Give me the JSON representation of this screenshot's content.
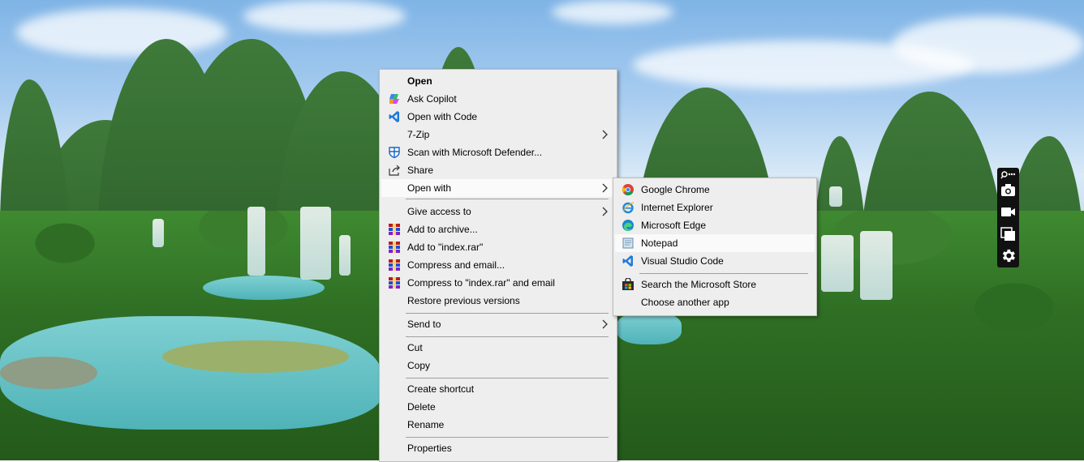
{
  "context_menu": {
    "items": [
      {
        "label": "Open",
        "bold": true,
        "icon": "none"
      },
      {
        "label": "Ask Copilot",
        "icon": "copilot-icon"
      },
      {
        "label": "Open with Code",
        "icon": "vscode-icon"
      },
      {
        "label": "7-Zip",
        "icon": "none",
        "submenu": true
      },
      {
        "label": "Scan with Microsoft Defender...",
        "icon": "defender-icon"
      },
      {
        "label": "Share",
        "icon": "share-icon"
      },
      {
        "label": "Open with",
        "icon": "none",
        "submenu": true,
        "highlighted": true
      },
      {
        "label": "Give access to",
        "icon": "none",
        "submenu": true
      },
      {
        "label": "Add to archive...",
        "icon": "winrar-icon"
      },
      {
        "label": "Add to \"index.rar\"",
        "icon": "winrar-icon"
      },
      {
        "label": "Compress and email...",
        "icon": "winrar-icon"
      },
      {
        "label": "Compress to \"index.rar\" and email",
        "icon": "winrar-icon"
      },
      {
        "label": "Restore previous versions",
        "icon": "none"
      },
      {
        "label": "Send to",
        "icon": "none",
        "submenu": true
      },
      {
        "label": "Cut",
        "icon": "none"
      },
      {
        "label": "Copy",
        "icon": "none"
      },
      {
        "label": "Create shortcut",
        "icon": "none"
      },
      {
        "label": "Delete",
        "icon": "none"
      },
      {
        "label": "Rename",
        "icon": "none"
      },
      {
        "label": "Properties",
        "icon": "none"
      }
    ]
  },
  "open_with_submenu": {
    "items": [
      {
        "label": "Google Chrome",
        "icon": "chrome-icon"
      },
      {
        "label": "Internet Explorer",
        "icon": "ie-icon"
      },
      {
        "label": "Microsoft Edge",
        "icon": "edge-icon"
      },
      {
        "label": "Notepad",
        "icon": "notepad-icon",
        "highlighted": true
      },
      {
        "label": "Visual Studio Code",
        "icon": "vscode-icon"
      },
      {
        "label": "Search the Microsoft Store",
        "icon": "store-icon"
      },
      {
        "label": "Choose another app",
        "icon": "none"
      }
    ]
  },
  "capture_toolbar": {
    "buttons": [
      "pin-icon",
      "camera-icon",
      "video-icon",
      "window-icon",
      "gear-icon"
    ]
  },
  "colors": {
    "menu_bg": "#eeeeee",
    "highlight_bg": "#fafafa",
    "separator": "#a0a0a0"
  }
}
